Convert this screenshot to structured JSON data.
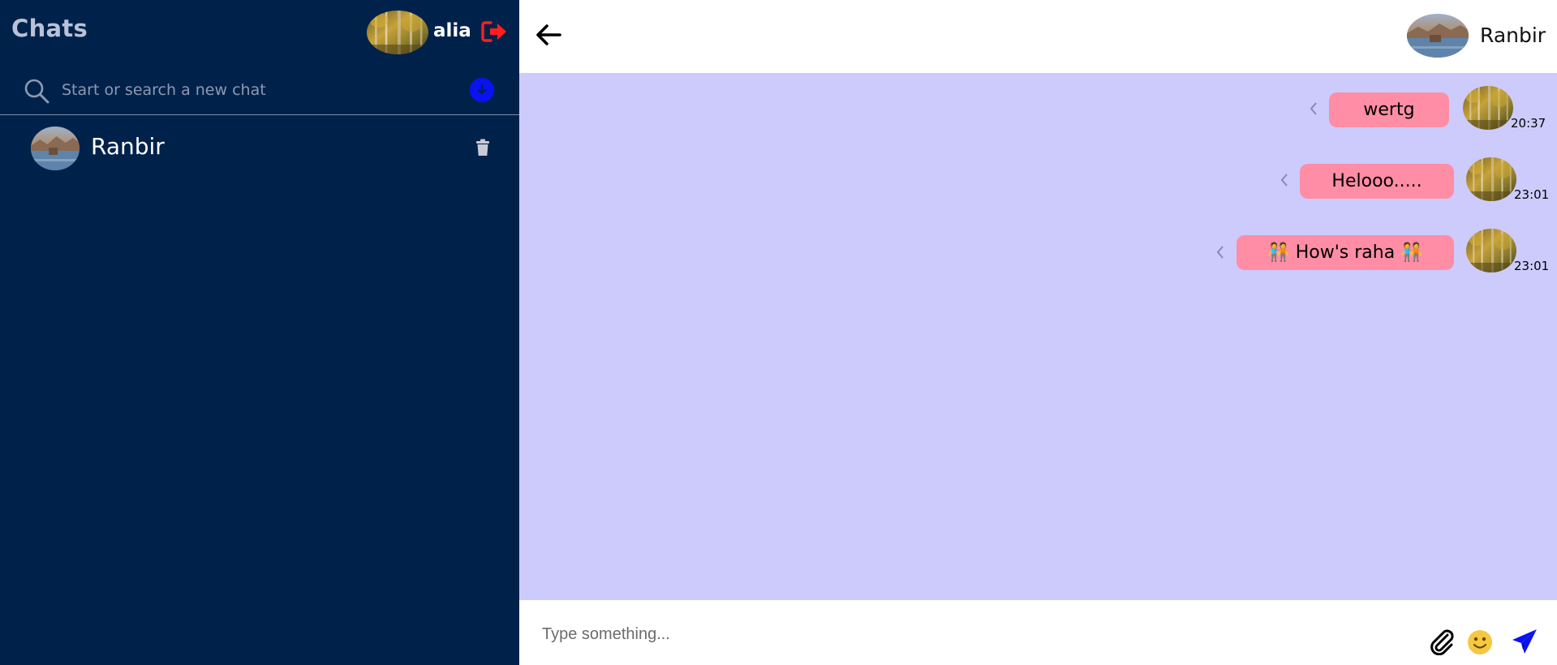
{
  "sidebar": {
    "title": "Chats",
    "user": {
      "name": "alia",
      "avatar": "forest-photo"
    },
    "logout_icon": "logout-icon",
    "search": {
      "placeholder": "Start or search a new chat",
      "value": ""
    },
    "new_chat_icon": "arrow-down-circle-icon",
    "chats": [
      {
        "name": "Ranbir",
        "avatar": "lake-photo"
      }
    ]
  },
  "header": {
    "back_icon": "arrow-left-icon",
    "contact_name": "Ranbir",
    "contact_avatar": "lake-photo"
  },
  "messages": [
    {
      "text": "wertg",
      "time": "20:37",
      "sender_avatar": "forest-photo"
    },
    {
      "text": "Helooo.....",
      "time": "23:01",
      "sender_avatar": "forest-photo"
    },
    {
      "text": "🧑‍🤝‍🧑 How's raha 🧑‍🤝‍🧑",
      "time": "23:01",
      "sender_avatar": "forest-photo"
    }
  ],
  "composer": {
    "placeholder": "Type something...",
    "value": ""
  },
  "colors": {
    "sidebar_bg": "#00224a",
    "chat_bg": "#cccbfc",
    "bubble_bg": "#fe8da5",
    "logout": "#ff1f1f",
    "accent_blue": "#0a12f2"
  }
}
